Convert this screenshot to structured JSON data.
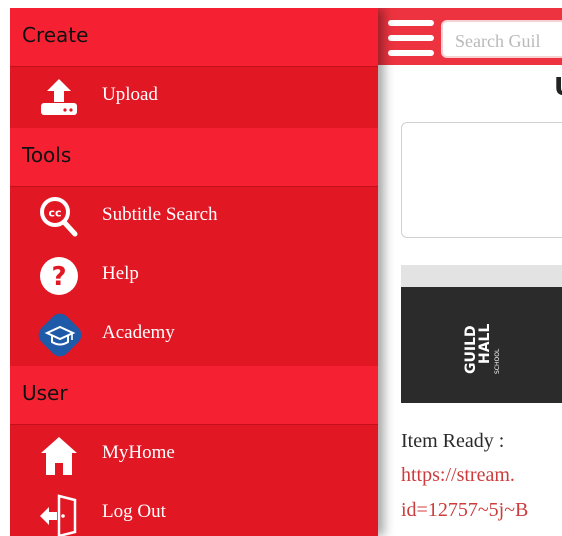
{
  "drawer": {
    "sections": [
      {
        "label": "Create"
      },
      {
        "label": "Tools"
      },
      {
        "label": "User"
      }
    ],
    "items": [
      {
        "label": "Upload",
        "icon": "upload-icon"
      },
      {
        "label": "Subtitle Search",
        "icon": "cc-search-icon"
      },
      {
        "label": "Help",
        "icon": "help-icon"
      },
      {
        "label": "Academy",
        "icon": "academy-icon"
      },
      {
        "label": "MyHome",
        "icon": "home-icon"
      },
      {
        "label": "Log Out",
        "icon": "logout-icon"
      }
    ]
  },
  "page": {
    "search_placeholder": "Search Guil",
    "title": "U",
    "media_logo_text": "GUILD HALL SCHOOL",
    "item_ready_label": "Item Ready :",
    "link_line1": "https://stream.",
    "link_line2": "id=12757~5j~B"
  },
  "colors": {
    "drawer": "#e11724",
    "section": "#f52132",
    "topbar": "#ee3340",
    "link": "#cc3c3c"
  }
}
